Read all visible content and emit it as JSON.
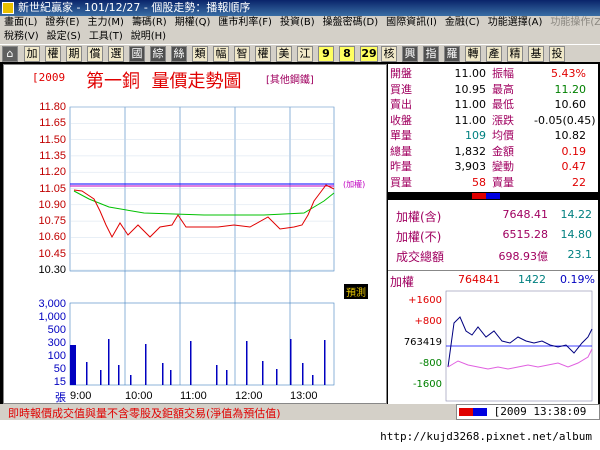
{
  "window": {
    "title": "新世紀贏家 - 101/12/27 - 個股走勢：播報順序"
  },
  "menu_row1": [
    "畫面(L)",
    "證券(E)",
    "主力(M)",
    "籌碼(R)",
    "期權(Q)",
    "匯市利率(F)",
    "投資(B)",
    "操盤密碼(D)",
    "國際資訊(I)",
    "金融(C)",
    "功能選擇(A)",
    "功能操作(Z)"
  ],
  "menu_row1_disabled": "功能操作(Z)",
  "menu_row2": [
    "稅務(V)",
    "設定(S)",
    "工具(T)",
    "說明(H)"
  ],
  "toolbar": [
    "加",
    "權",
    "期",
    "償",
    "選",
    "國",
    "綜",
    "絲",
    "類",
    "幅",
    "智",
    "權",
    "美",
    "江",
    "9",
    "8",
    "29",
    "核",
    "興",
    "指",
    "羅",
    "轉",
    "產",
    "精",
    "基",
    "投"
  ],
  "stock": {
    "code": "[2009",
    "name": "第一銅",
    "subtitle": "量價走勢圖",
    "industry": "[其他鋼鐵]"
  },
  "price_axis": [
    "11.80",
    "11.65",
    "11.50",
    "11.35",
    "11.20",
    "11.05",
    "10.90",
    "10.75",
    "10.60",
    "10.45",
    "10.30"
  ],
  "volume_axis": [
    "3,000",
    "1,000",
    "500",
    "300",
    "100",
    "50",
    "15",
    "張"
  ],
  "time_axis": [
    "9:00",
    "10:00",
    "11:00",
    "12:00",
    "13:00"
  ],
  "chart_labels": {
    "weighted": "(加權)",
    "forecast": "預測"
  },
  "quote": [
    {
      "l1": "開盤",
      "v1": "11.00",
      "c1": "#000000",
      "l2": "振幅",
      "v2": "5.43%",
      "c2": "#e00000"
    },
    {
      "l1": "買進",
      "v1": "10.95",
      "c1": "#000000",
      "l2": "最高",
      "v2": "11.20",
      "c2": "#008000"
    },
    {
      "l1": "賣出",
      "v1": "11.00",
      "c1": "#000000",
      "l2": "最低",
      "v2": "10.60",
      "c2": "#000000"
    },
    {
      "l1": "收盤",
      "v1": "11.00",
      "c1": "#000000",
      "l2": "漲跌",
      "v2": "-0.05(0.45)",
      "c2": "#000000"
    },
    {
      "l1": "單量",
      "v1": "109",
      "c1": "#008080",
      "l2": "均價",
      "v2": "10.82",
      "c2": "#000000"
    },
    {
      "l1": "總量",
      "v1": "1,832",
      "c1": "#000000",
      "l2": "金額",
      "v2": "0.19",
      "c2": "#e00000"
    },
    {
      "l1": "昨量",
      "v1": "3,903",
      "c1": "#000000",
      "l2": "變動",
      "v2": "0.47",
      "c2": "#e00000"
    },
    {
      "l1": "買量",
      "v1": "58",
      "c1": "#e00000",
      "l2": "賣量",
      "v2": "22",
      "c2": "#e00000"
    }
  ],
  "index_rows": [
    {
      "label": "加權(含)",
      "value": "7648.41",
      "change": "14.22"
    },
    {
      "label": "加權(不)",
      "value": "6515.28",
      "change": "14.80"
    },
    {
      "label": "成交總額",
      "value": "698.93億",
      "change": "23.1"
    }
  ],
  "mini": {
    "label": "加權",
    "value": "764841",
    "change": "1422",
    "pct": "0.19%",
    "axis": [
      "+1600",
      "+800",
      "763419",
      "-800",
      "-1600"
    ]
  },
  "footer": {
    "note": "即時報價成交值與量不含零股及鉅額交易(淨值為預估值)",
    "code": "[2009",
    "time": "13:38:09"
  },
  "url": "http://kujd3268.pixnet.net/album",
  "colors": {
    "price_line": "#e00000",
    "avg_line": "#00c000",
    "ref_line": "#0000ff",
    "index_line": "#c000c0",
    "volume_bar": "#0000c0",
    "grid": "#4080c0"
  }
}
